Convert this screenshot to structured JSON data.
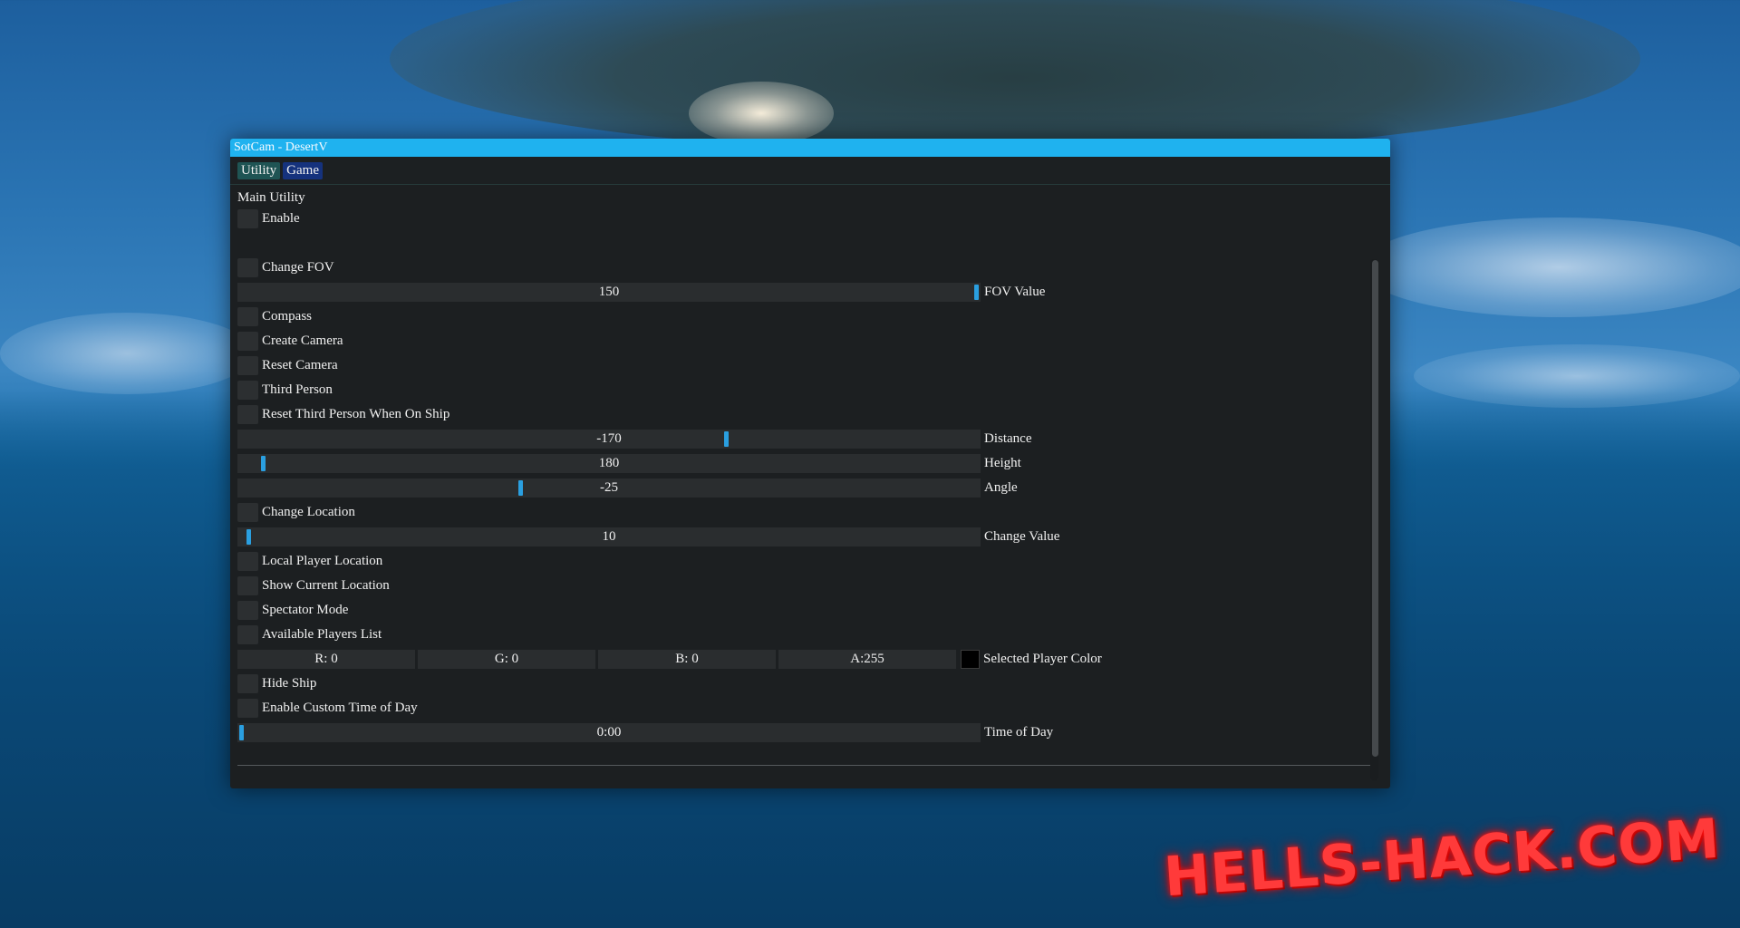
{
  "window": {
    "title": "SotCam - DesertV"
  },
  "tabs": [
    {
      "label": "Utility"
    },
    {
      "label": "Game"
    }
  ],
  "section": {
    "title": "Main Utility"
  },
  "items": {
    "enable": "Enable",
    "change_fov": "Change FOV",
    "compass": "Compass",
    "create_camera": "Create Camera",
    "reset_camera": "Reset Camera",
    "third_person": "Third Person",
    "reset_third_person": "Reset Third Person When On Ship",
    "change_location": "Change Location",
    "local_player_location": "Local Player Location",
    "show_current_location": "Show Current Location",
    "spectator_mode": "Spectator Mode",
    "available_players_list": "Available Players List",
    "hide_ship": "Hide Ship",
    "enable_custom_time": "Enable Custom Time of Day"
  },
  "sliders": {
    "fov": {
      "value": "150",
      "label": "FOV Value",
      "fraction": 1.0
    },
    "distance": {
      "value": "-170",
      "label": "Distance",
      "fraction": 0.66
    },
    "height": {
      "value": "180",
      "label": "Height",
      "fraction": 0.03
    },
    "angle": {
      "value": "-25",
      "label": "Angle",
      "fraction": 0.38
    },
    "change_value": {
      "value": "10",
      "label": "Change Value",
      "fraction": 0.01
    },
    "time_of_day": {
      "value": "0:00",
      "label": "Time of Day",
      "fraction": 0.0
    }
  },
  "player_color": {
    "r": "R:  0",
    "g": "G:  0",
    "b": "B:  0",
    "a": "A:255",
    "swatch": "#000000",
    "label": "Selected Player Color"
  },
  "watermark": "HELLS-HACK.COM",
  "colors": {
    "titlebar": "#1fb2ef",
    "slider_grab": "#2a9fe0",
    "tab_utility": "#1f5454",
    "tab_game": "#15327d",
    "watermark": "#ff3a3a"
  }
}
